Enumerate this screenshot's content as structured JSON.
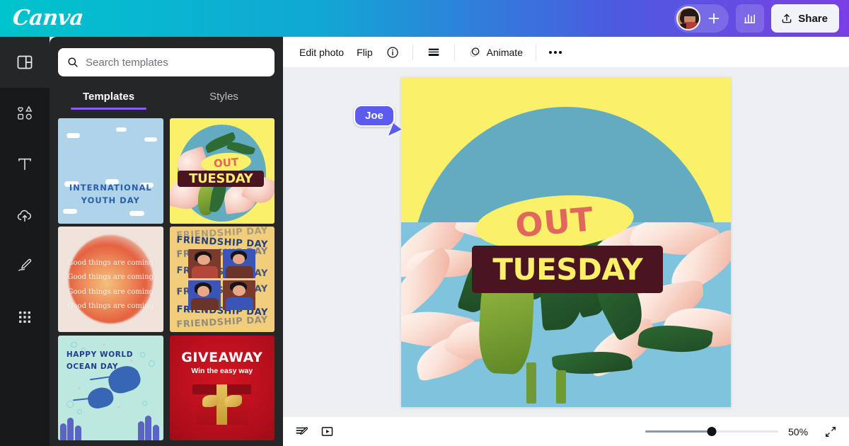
{
  "topbar": {
    "logo": "Canva",
    "avatar_name": "avatar",
    "add_label": "+",
    "insights_label": "insights",
    "share_label": "Share"
  },
  "rail": {
    "items": [
      {
        "id": "templates",
        "icon": "layout-panel-icon",
        "active": true
      },
      {
        "id": "elements",
        "icon": "shapes-icon",
        "active": false
      },
      {
        "id": "text",
        "icon": "text-t-icon",
        "active": false
      },
      {
        "id": "uploads",
        "icon": "cloud-upload-icon",
        "active": false
      },
      {
        "id": "draw",
        "icon": "pen-draw-icon",
        "active": false
      },
      {
        "id": "apps",
        "icon": "grid-dots-icon",
        "active": false
      }
    ]
  },
  "panel": {
    "search": {
      "placeholder": "Search templates",
      "value": ""
    },
    "tabs": [
      {
        "label": "Templates",
        "active": true
      },
      {
        "label": "Styles",
        "active": false
      }
    ],
    "templates": [
      {
        "id": "international-youth-day",
        "title_line1": "INTERNATIONAL",
        "title_line2": "YOUTH DAY"
      },
      {
        "id": "out-tuesday",
        "title_line1": "OUT",
        "title_line2": "TUESDAY"
      },
      {
        "id": "good-things-are-coming",
        "line": "Good things are coming"
      },
      {
        "id": "friendship-day",
        "title": "FRIENDSHIP DAY"
      },
      {
        "id": "happy-world-ocean-day",
        "title_line1": "HAPPY WORLD",
        "title_line2": "OCEAN DAY"
      },
      {
        "id": "giveaway",
        "title": "GIVEAWAY",
        "subtitle": "Win the easy way"
      }
    ]
  },
  "toolbar": {
    "edit_photo_label": "Edit photo",
    "flip_label": "Flip",
    "info_label": "i",
    "position_label": "position",
    "animate_label": "Animate",
    "more_label": "more options"
  },
  "canvas": {
    "oval_text": "OUT",
    "bar_text": "TUESDAY",
    "colors": {
      "background": "#FAF06A",
      "circle": "#62ABC0",
      "oval_text": "#E0675B",
      "bar_background": "#4A1520",
      "bar_text": "#FAF06A"
    }
  },
  "collaborator": {
    "name": "Joe",
    "color": "#5B5BEE"
  },
  "bottombar": {
    "notes_label": "notes",
    "present_label": "present",
    "zoom_value": "50%",
    "zoom_percent": 50,
    "fullscreen_label": "fullscreen"
  }
}
